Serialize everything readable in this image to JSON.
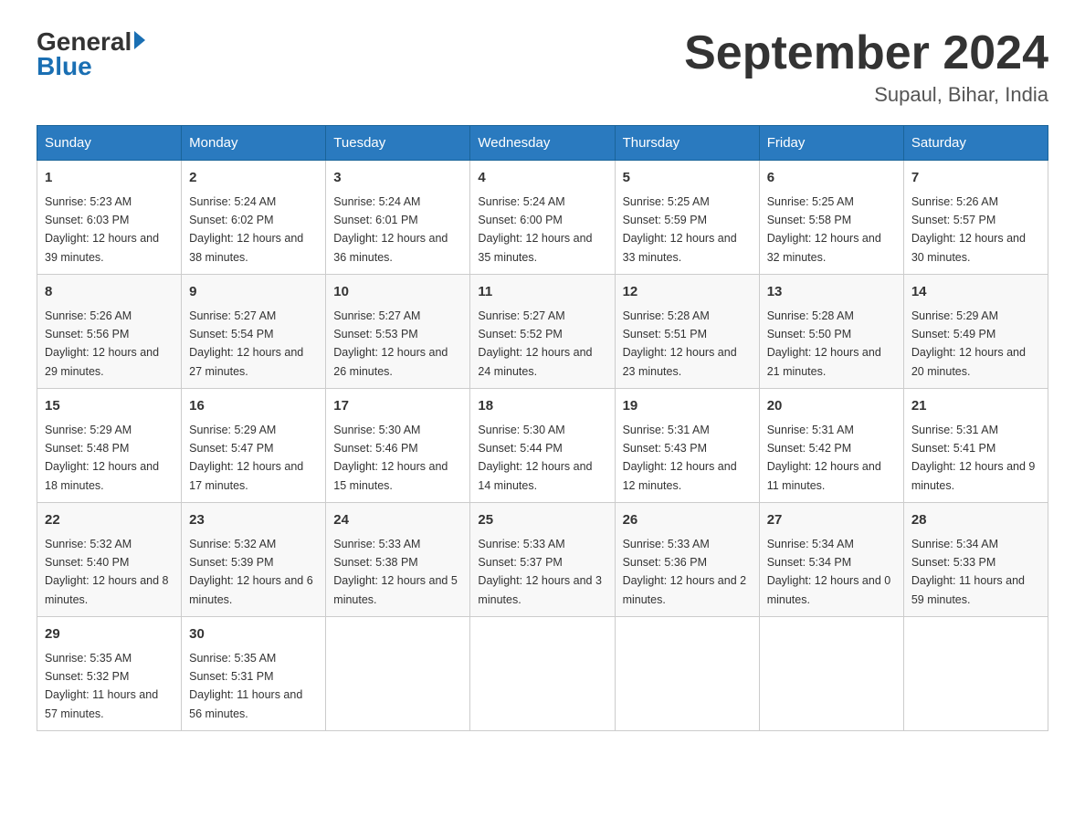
{
  "header": {
    "logo_general": "General",
    "logo_blue": "Blue",
    "main_title": "September 2024",
    "subtitle": "Supaul, Bihar, India"
  },
  "days_of_week": [
    "Sunday",
    "Monday",
    "Tuesday",
    "Wednesday",
    "Thursday",
    "Friday",
    "Saturday"
  ],
  "weeks": [
    [
      {
        "day": "1",
        "sunrise": "5:23 AM",
        "sunset": "6:03 PM",
        "daylight": "12 hours and 39 minutes."
      },
      {
        "day": "2",
        "sunrise": "5:24 AM",
        "sunset": "6:02 PM",
        "daylight": "12 hours and 38 minutes."
      },
      {
        "day": "3",
        "sunrise": "5:24 AM",
        "sunset": "6:01 PM",
        "daylight": "12 hours and 36 minutes."
      },
      {
        "day": "4",
        "sunrise": "5:24 AM",
        "sunset": "6:00 PM",
        "daylight": "12 hours and 35 minutes."
      },
      {
        "day": "5",
        "sunrise": "5:25 AM",
        "sunset": "5:59 PM",
        "daylight": "12 hours and 33 minutes."
      },
      {
        "day": "6",
        "sunrise": "5:25 AM",
        "sunset": "5:58 PM",
        "daylight": "12 hours and 32 minutes."
      },
      {
        "day": "7",
        "sunrise": "5:26 AM",
        "sunset": "5:57 PM",
        "daylight": "12 hours and 30 minutes."
      }
    ],
    [
      {
        "day": "8",
        "sunrise": "5:26 AM",
        "sunset": "5:56 PM",
        "daylight": "12 hours and 29 minutes."
      },
      {
        "day": "9",
        "sunrise": "5:27 AM",
        "sunset": "5:54 PM",
        "daylight": "12 hours and 27 minutes."
      },
      {
        "day": "10",
        "sunrise": "5:27 AM",
        "sunset": "5:53 PM",
        "daylight": "12 hours and 26 minutes."
      },
      {
        "day": "11",
        "sunrise": "5:27 AM",
        "sunset": "5:52 PM",
        "daylight": "12 hours and 24 minutes."
      },
      {
        "day": "12",
        "sunrise": "5:28 AM",
        "sunset": "5:51 PM",
        "daylight": "12 hours and 23 minutes."
      },
      {
        "day": "13",
        "sunrise": "5:28 AM",
        "sunset": "5:50 PM",
        "daylight": "12 hours and 21 minutes."
      },
      {
        "day": "14",
        "sunrise": "5:29 AM",
        "sunset": "5:49 PM",
        "daylight": "12 hours and 20 minutes."
      }
    ],
    [
      {
        "day": "15",
        "sunrise": "5:29 AM",
        "sunset": "5:48 PM",
        "daylight": "12 hours and 18 minutes."
      },
      {
        "day": "16",
        "sunrise": "5:29 AM",
        "sunset": "5:47 PM",
        "daylight": "12 hours and 17 minutes."
      },
      {
        "day": "17",
        "sunrise": "5:30 AM",
        "sunset": "5:46 PM",
        "daylight": "12 hours and 15 minutes."
      },
      {
        "day": "18",
        "sunrise": "5:30 AM",
        "sunset": "5:44 PM",
        "daylight": "12 hours and 14 minutes."
      },
      {
        "day": "19",
        "sunrise": "5:31 AM",
        "sunset": "5:43 PM",
        "daylight": "12 hours and 12 minutes."
      },
      {
        "day": "20",
        "sunrise": "5:31 AM",
        "sunset": "5:42 PM",
        "daylight": "12 hours and 11 minutes."
      },
      {
        "day": "21",
        "sunrise": "5:31 AM",
        "sunset": "5:41 PM",
        "daylight": "12 hours and 9 minutes."
      }
    ],
    [
      {
        "day": "22",
        "sunrise": "5:32 AM",
        "sunset": "5:40 PM",
        "daylight": "12 hours and 8 minutes."
      },
      {
        "day": "23",
        "sunrise": "5:32 AM",
        "sunset": "5:39 PM",
        "daylight": "12 hours and 6 minutes."
      },
      {
        "day": "24",
        "sunrise": "5:33 AM",
        "sunset": "5:38 PM",
        "daylight": "12 hours and 5 minutes."
      },
      {
        "day": "25",
        "sunrise": "5:33 AM",
        "sunset": "5:37 PM",
        "daylight": "12 hours and 3 minutes."
      },
      {
        "day": "26",
        "sunrise": "5:33 AM",
        "sunset": "5:36 PM",
        "daylight": "12 hours and 2 minutes."
      },
      {
        "day": "27",
        "sunrise": "5:34 AM",
        "sunset": "5:34 PM",
        "daylight": "12 hours and 0 minutes."
      },
      {
        "day": "28",
        "sunrise": "5:34 AM",
        "sunset": "5:33 PM",
        "daylight": "11 hours and 59 minutes."
      }
    ],
    [
      {
        "day": "29",
        "sunrise": "5:35 AM",
        "sunset": "5:32 PM",
        "daylight": "11 hours and 57 minutes."
      },
      {
        "day": "30",
        "sunrise": "5:35 AM",
        "sunset": "5:31 PM",
        "daylight": "11 hours and 56 minutes."
      },
      null,
      null,
      null,
      null,
      null
    ]
  ]
}
